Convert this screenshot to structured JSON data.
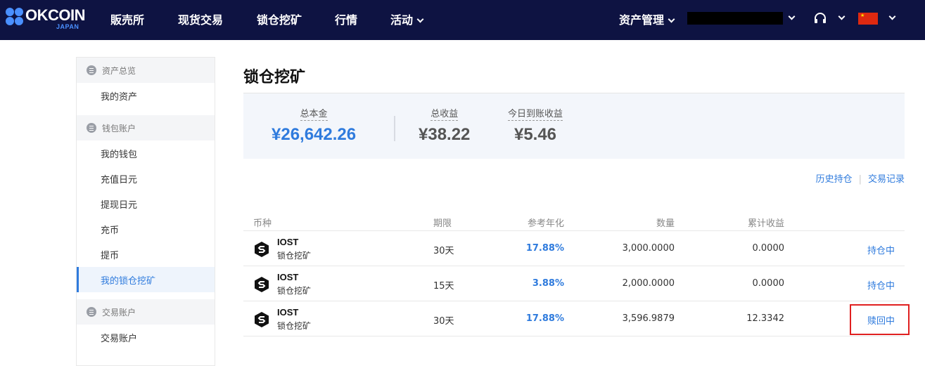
{
  "header": {
    "logo_text": "OKCOIN",
    "logo_sub": "JAPAN",
    "nav": [
      "販売所",
      "现货交易",
      "锁仓挖矿",
      "行情",
      "活动"
    ],
    "asset_menu": "资产管理"
  },
  "sidebar": {
    "groups": [
      {
        "title": "资产总览",
        "items": [
          "我的资产"
        ]
      },
      {
        "title": "钱包账户",
        "items": [
          "我的钱包",
          "充值日元",
          "提现日元",
          "充币",
          "提币",
          "我的锁仓挖矿"
        ]
      },
      {
        "title": "交易账户",
        "items": [
          "交易账户"
        ]
      }
    ],
    "active_item": "我的锁仓挖矿"
  },
  "main": {
    "title": "锁仓挖矿",
    "summary": [
      {
        "label": "总本金",
        "value": "¥26,642.26"
      },
      {
        "label": "总收益",
        "value": "¥38.22"
      },
      {
        "label": "今日到账收益",
        "value": "¥5.46"
      }
    ],
    "links": [
      "历史持仓",
      "交易记录"
    ],
    "table": {
      "columns": [
        "币种",
        "期限",
        "参考年化",
        "数量",
        "累计收益"
      ],
      "rows": [
        {
          "coin": "IOST",
          "type": "锁仓挖矿",
          "term": "30天",
          "apr": "17.88%",
          "amount": "3,000.0000",
          "earnings": "0.0000",
          "status": "持仓中"
        },
        {
          "coin": "IOST",
          "type": "锁仓挖矿",
          "term": "15天",
          "apr": "3.88%",
          "amount": "2,000.0000",
          "earnings": "0.0000",
          "status": "持仓中"
        },
        {
          "coin": "IOST",
          "type": "锁仓挖矿",
          "term": "30天",
          "apr": "17.88%",
          "amount": "3,596.9879",
          "earnings": "12.3342",
          "status": "赎回中"
        }
      ]
    }
  },
  "colors": {
    "nav_bg": "#0e1342",
    "accent": "#2f7bdd",
    "highlight": "#e02020"
  }
}
